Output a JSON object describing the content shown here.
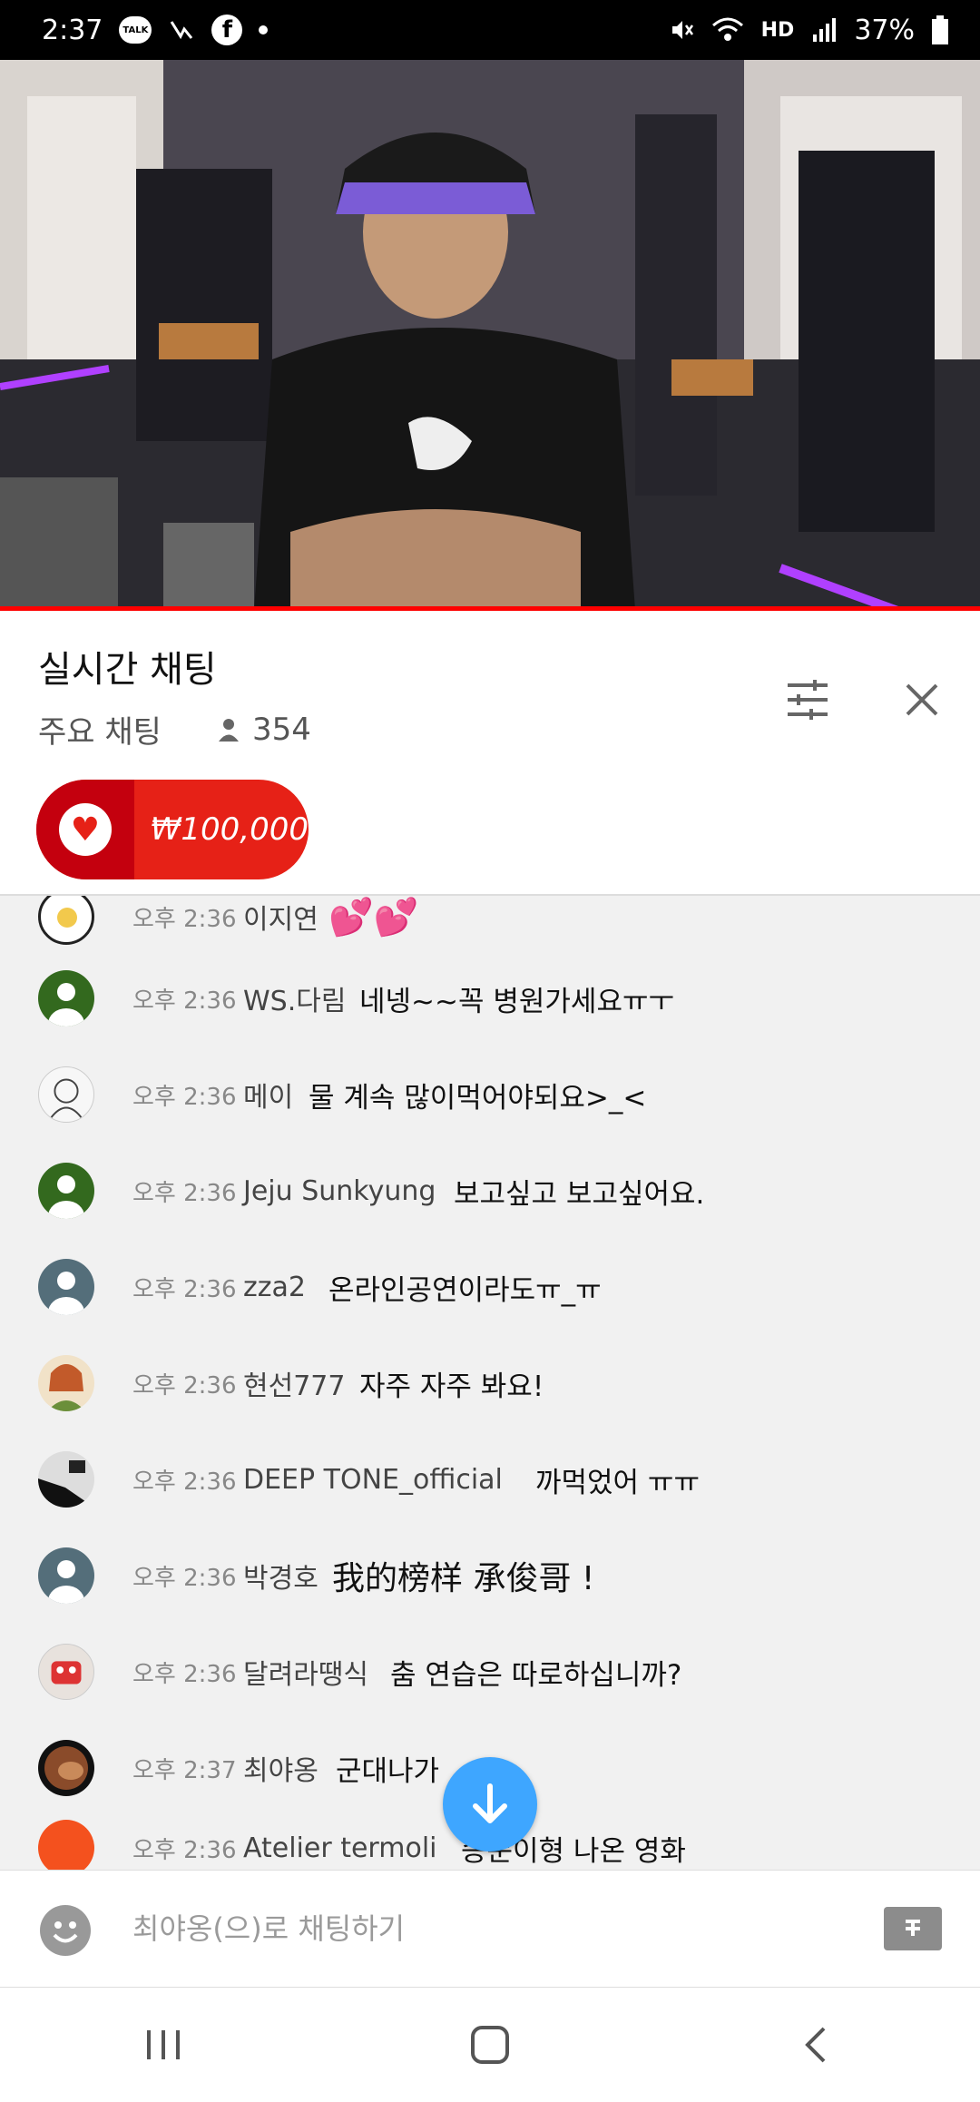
{
  "status_bar": {
    "time": "2:37",
    "talk_label": "TALK",
    "battery": "37%",
    "hd_label": "HD"
  },
  "chat": {
    "title": "실시간 채팅",
    "mode": "주요 채팅",
    "viewer_count": "354",
    "superchat_amount": "₩100,000"
  },
  "messages": [
    {
      "time": "오후 2:36",
      "author": "이지연",
      "text": "💕💕",
      "avatar_color": "#ffffff"
    },
    {
      "time": "오후 2:36",
      "author": "WS.다림",
      "text": "네넹~~꼭 병원가세요ㅠㅜ",
      "avatar_color": "#33691e"
    },
    {
      "time": "오후 2:36",
      "author": "메이",
      "text": "물 계속 많이먹어야되요>_<",
      "avatar_color": "#f5f5f5"
    },
    {
      "time": "오후 2:36",
      "author": "Jeju Sunkyung",
      "text": "보고싶고 보고싶어요.",
      "avatar_color": "#33691e"
    },
    {
      "time": "오후 2:36",
      "author": "zza2",
      "text": "온라인공연이라도ㅠ_ㅠ",
      "avatar_color": "#546e7a"
    },
    {
      "time": "오후 2:36",
      "author": "현선777",
      "text": "자주 자주 봐요!",
      "avatar_color": "#e0c8a0"
    },
    {
      "time": "오후 2:36",
      "author": "DEEP TONE_official",
      "text": "까먹었어 ㅠㅠ",
      "avatar_color": "#222222"
    },
    {
      "time": "오후 2:36",
      "author": "박경호",
      "text": "我的榜样 承俊哥 !",
      "avatar_color": "#546e7a"
    },
    {
      "time": "오후 2:36",
      "author": "달려라땡식",
      "text": "춤 연습은 따로하십니까?",
      "avatar_color": "#d8d0cc"
    },
    {
      "time": "오후 2:37",
      "author": "최야옹",
      "text": "군대나가",
      "avatar_color": "#6d3f24"
    },
    {
      "time": "오후 2:36",
      "author": "Atelier termoli",
      "text": "승순이형 나온 영화",
      "avatar_color": "#f4511e"
    }
  ],
  "input": {
    "placeholder": "최야옹(으)로 채팅하기"
  },
  "icons": {
    "filter": "tune-icon",
    "close": "close-icon",
    "scroll": "arrow-down-icon",
    "emoji": "emoji-icon",
    "superchat": "superchat-icon"
  },
  "colors": {
    "accent_blue": "#3ea6ff",
    "youtube_red": "#ff0000",
    "superchat_red": "#e62117"
  }
}
